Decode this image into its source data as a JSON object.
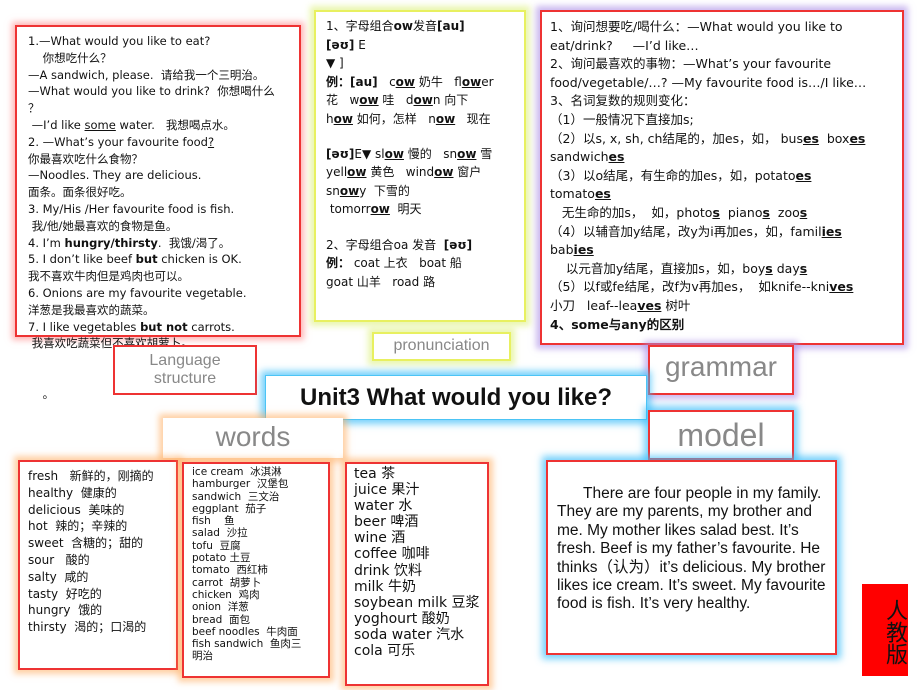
{
  "title": "Unit3  What would you like?",
  "labels": {
    "language": "Language structure",
    "pronunciation": "pronunciation",
    "grammar": "grammar",
    "words": "words",
    "model": "model"
  },
  "language_lines": [
    [
      "1.—What would you like to eat?"
    ],
    [
      "    你想吃什么？"
    ],
    [
      "—A sandwich, please.  请给我一个三明治。"
    ],
    [
      "—What would you like to drink?  你想喝什么"
    ],
    [
      "？"
    ],
    [
      " —I’d like ",
      {
        "t": "some",
        "u": 1
      },
      " water.   我想喝点水。"
    ],
    [
      "2. —What’s your favourite food",
      {
        "t": "?",
        "u": 1
      }
    ],
    [
      "你最喜欢吃什么食物？"
    ],
    [
      "—Noodles. They are delicious."
    ],
    [
      "面条。面条很好吃。"
    ],
    [
      "3. My/His /Her favourite food is fish."
    ],
    [
      " 我/他/她最喜欢的食物是鱼。"
    ],
    [
      "4. I’m ",
      {
        "t": "hungry/thirsty",
        "b": 1
      },
      ".  我饿/渴了。"
    ],
    [
      "5. I don’t like beef ",
      {
        "t": "but",
        "b": 1
      },
      " chicken is OK."
    ],
    [
      "我不喜欢牛肉但是鸡肉也可以。"
    ],
    [
      "6. Onions are my favourite vegetable."
    ],
    [
      "洋葱是我最喜欢的蔬菜。"
    ],
    [
      "7. I like vegetables ",
      {
        "t": "but not",
        "b": 1
      },
      " carrots."
    ],
    [
      " 我喜欢吃蔬菜但不喜欢胡萝卜。"
    ],
    [
      ""
    ],
    [
      ""
    ],
    [
      "    。"
    ]
  ],
  "pron_lines": [
    [
      "1、字母组合",
      {
        "t": "ow",
        "b": 1
      },
      "发音",
      {
        "t": "[au]",
        "b": 1
      }
    ],
    [
      {
        "t": "[əʊ]",
        "b": 1
      },
      " E"
    ],
    [
      "▼ ]"
    ],
    [
      {
        "t": "例：[au]",
        "b": 1
      },
      "   c",
      {
        "t": "ow",
        "u": 1,
        "b": 1
      },
      " 奶牛   fl",
      {
        "t": "ow",
        "u": 1,
        "b": 1
      },
      "er"
    ],
    [
      "花   w",
      {
        "t": "ow",
        "u": 1,
        "b": 1
      },
      " 哇   d",
      {
        "t": "ow",
        "u": 1,
        "b": 1
      },
      "n 向下"
    ],
    [
      "h",
      {
        "t": "ow",
        "u": 1,
        "b": 1
      },
      " 如何，怎样   n",
      {
        "t": "ow",
        "u": 1,
        "b": 1
      },
      "   现在"
    ],
    [
      ""
    ],
    [
      {
        "t": "[əʊ]",
        "b": 1
      },
      "E▼ sl",
      {
        "t": "ow",
        "u": 1,
        "b": 1
      },
      " 慢的   sn",
      {
        "t": "ow",
        "u": 1,
        "b": 1
      },
      " 雪"
    ],
    [
      "yell",
      {
        "t": "ow",
        "u": 1,
        "b": 1
      },
      " 黄色   wind",
      {
        "t": "ow",
        "u": 1,
        "b": 1
      },
      " 窗户"
    ],
    [
      "sn",
      {
        "t": "ow",
        "u": 1,
        "b": 1
      },
      "y  下雪的"
    ],
    [
      " tomorr",
      {
        "t": "ow",
        "u": 1,
        "b": 1
      },
      "  明天"
    ],
    [
      ""
    ],
    [
      "2、字母组合oa 发音  ",
      {
        "t": "[əʊ]",
        "b": 1
      }
    ],
    [
      {
        "t": "例：",
        "b": 1
      },
      " coat 上衣   boat 船"
    ],
    [
      "goat 山羊   road 路"
    ]
  ],
  "grammar_lines": [
    [
      "1、询问想要吃/喝什么：—What would you like to"
    ],
    [
      "eat/drink?     —I’d like…"
    ],
    [
      "2、询问最喜欢的事物：—What’s your favourite"
    ],
    [
      "food/vegetable/…? —My favourite food is…/I like…"
    ],
    [
      "3、名词复数的规则变化："
    ],
    [
      "（1）一般情况下直接加s;"
    ],
    [
      "（2）以s, x, sh, ch结尾的，加es，如， bus",
      {
        "t": "es",
        "u": 1,
        "b": 1
      },
      "  box",
      {
        "t": "es",
        "u": 1,
        "b": 1
      }
    ],
    [
      "sandwich",
      {
        "t": "es",
        "u": 1,
        "b": 1
      }
    ],
    [
      "（3）以o结尾，有生命的加es，如，potato",
      {
        "t": "es",
        "u": 1,
        "b": 1
      }
    ],
    [
      "tomato",
      {
        "t": "es",
        "u": 1,
        "b": 1
      }
    ],
    [
      "   无生命的加s，  如，photo",
      {
        "t": "s",
        "u": 1,
        "b": 1
      },
      "  piano",
      {
        "t": "s",
        "u": 1,
        "b": 1
      },
      "  zoo",
      {
        "t": "s",
        "u": 1,
        "b": 1
      }
    ],
    [
      "（4）以辅音加y结尾，改y为i再加es，如，famil",
      {
        "t": "ies",
        "u": 1,
        "b": 1
      }
    ],
    [
      "bab",
      {
        "t": "ies",
        "u": 1,
        "b": 1
      }
    ],
    [
      "    以元音加y结尾，直接加s，如，boy",
      {
        "t": "s",
        "u": 1,
        "b": 1
      },
      " day",
      {
        "t": "s",
        "u": 1,
        "b": 1
      }
    ],
    [
      "（5）以f或fe结尾，改f为v再加es，  如knife--kni",
      {
        "t": "ves",
        "u": 1,
        "b": 1
      }
    ],
    [
      "小刀   leaf--lea",
      {
        "t": "ves",
        "u": 1,
        "b": 1
      },
      " 树叶"
    ],
    [
      {
        "t": "4、some与any的区别",
        "b": 1
      }
    ]
  ],
  "words_adj": [
    "fresh   新鲜的，刚摘的",
    "healthy  健康的",
    "delicious  美味的",
    "hot  辣的；辛辣的",
    "sweet  含糖的；甜的",
    "sour   酸的",
    "salty  咸的",
    "tasty  好吃的",
    "hungry  饿的",
    "thirsty  渴的；口渴的"
  ],
  "words_food": [
    "ice cream  冰淇淋",
    "hamburger  汉堡包",
    "sandwich  三文治",
    "eggplant  茄子",
    "fish    鱼",
    "salad  沙拉",
    "tofu  豆腐",
    "potato 土豆",
    "tomato  西红柿",
    "carrot  胡萝卜",
    "chicken  鸡肉",
    "onion  洋葱",
    "bread  面包",
    "beef noodles  牛肉面",
    "fish sandwich  鱼肉三",
    "明治"
  ],
  "words_drink": [
    "tea 茶",
    "juice 果汁",
    "water 水",
    "beer 啤酒",
    "wine 酒",
    "coffee 咖啡",
    "drink 饮料",
    "milk 牛奶",
    "soybean milk 豆浆",
    "yoghourt 酸奶",
    "soda water 汽水",
    "cola 可乐"
  ],
  "model_text": "There are four people in my family. They are my parents, my brother and me. My mother likes salad best. It’s fresh. Beef is my father’s favourite. He thinks（认为）it’s delicious. My brother likes ice cream. It’s sweet. My favourite food is fish. It’s very healthy.",
  "stamp": "人教版",
  "colors": {
    "red": "#ee3333",
    "label_gray": "#888888",
    "stamp_red": "#ff0000"
  }
}
